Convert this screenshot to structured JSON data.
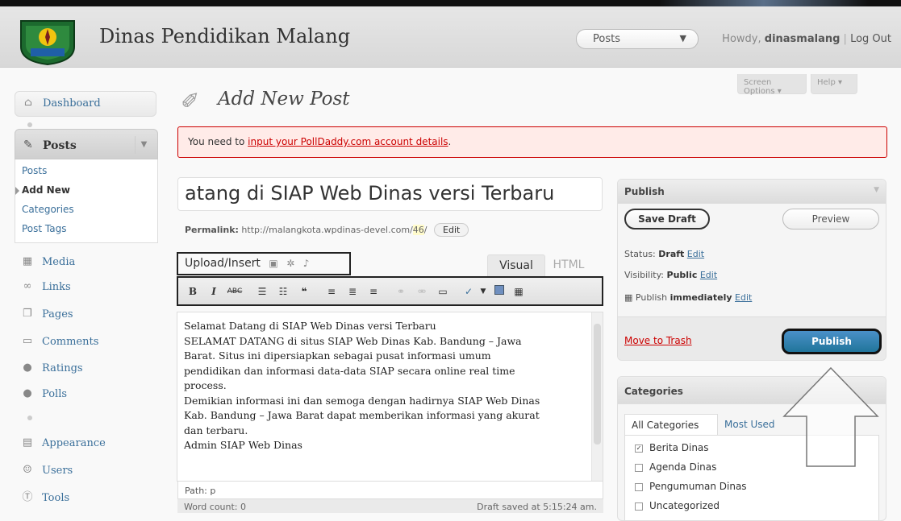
{
  "header": {
    "site_title": "Dinas Pendidikan Malang",
    "favorites_selected": "Posts",
    "howdy_prefix": "Howdy,",
    "username": "dinasmalang",
    "separator": "|",
    "logout_label": "Log Out"
  },
  "screen_options": {
    "screen_options_label": "Screen Options ▾",
    "help_label": "Help ▾"
  },
  "sidebar": {
    "dashboard": "Dashboard",
    "posts": "Posts",
    "posts_submenu": [
      "Posts",
      "Add New",
      "Categories",
      "Post Tags"
    ],
    "items": [
      "Media",
      "Links",
      "Pages",
      "Comments",
      "Ratings",
      "Polls"
    ],
    "items2": [
      "Appearance",
      "Users",
      "Tools"
    ]
  },
  "main": {
    "page_title": "Add New Post",
    "notice_prefix": "You need to ",
    "notice_link": "input your PollDaddy.com account details",
    "notice_suffix": ".",
    "post_title": "atang di SIAP Web Dinas versi Terbaru",
    "permalink_label": "Permalink:",
    "permalink_base": "http://malangkota.wpdinas-devel.com/",
    "permalink_slug": "46",
    "permalink_trail": "/",
    "permalink_edit": "Edit",
    "upload_insert": "Upload/Insert",
    "tab_visual": "Visual",
    "tab_html": "HTML",
    "editor_lines": [
      "Selamat Datang di SIAP Web Dinas versi Terbaru",
      "SELAMAT DATANG di situs SIAP Web Dinas Kab. Bandung – Jawa",
      "Barat. Situs ini dipersiapkan sebagai pusat informasi umum",
      "pendidikan dan informasi data-data SIAP secara online real time",
      "process.",
      "Demikian informasi ini dan semoga dengan hadirnya SIAP Web Dinas",
      "Kab. Bandung – Jawa Barat dapat memberikan informasi yang akurat",
      "dan terbaru.",
      "Admin SIAP Web Dinas"
    ],
    "path": "Path: p",
    "word_count": "Word count: 0",
    "draft_saved": "Draft saved at 5:15:24 am."
  },
  "publish": {
    "title": "Publish",
    "save_draft": "Save Draft",
    "preview": "Preview",
    "status_label": "Status:",
    "status_value": "Draft",
    "visibility_label": "Visibility:",
    "visibility_value": "Public",
    "publish_label": "Publish",
    "publish_value": "immediately",
    "edit": "Edit",
    "move_to_trash": "Move to Trash",
    "publish_button": "Publish"
  },
  "categories": {
    "title": "Categories",
    "tab_all": "All Categories",
    "tab_most_used": "Most Used",
    "items": [
      {
        "label": "Berita Dinas",
        "checked": true
      },
      {
        "label": "Agenda Dinas",
        "checked": false
      },
      {
        "label": "Pengumuman Dinas",
        "checked": false
      },
      {
        "label": "Uncategorized",
        "checked": false
      }
    ]
  },
  "colors": {
    "accent": "#21759b",
    "link": "#3a6f9a",
    "error": "#cc0000"
  }
}
